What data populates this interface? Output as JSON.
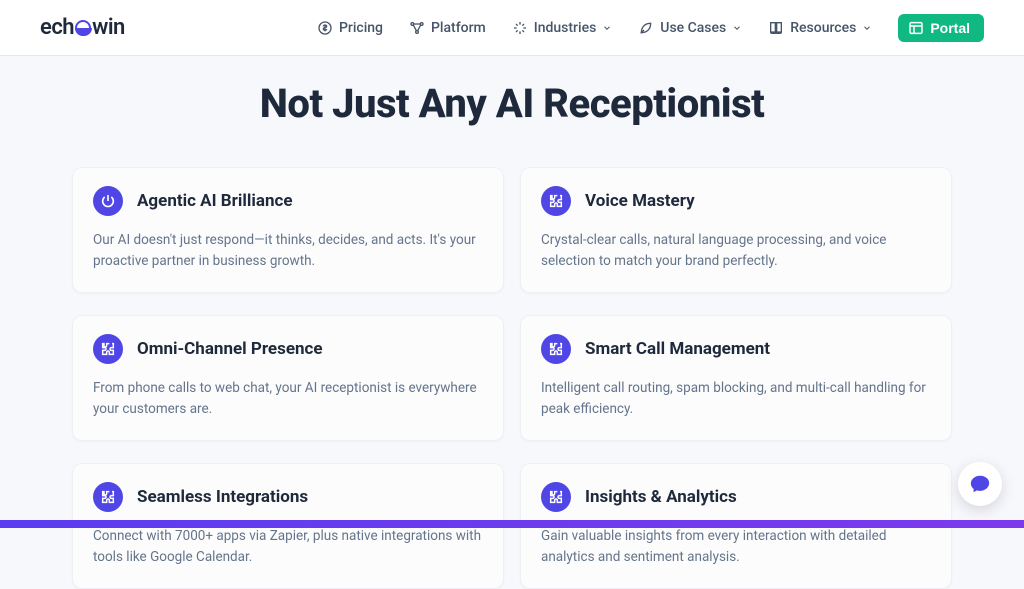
{
  "brand": {
    "ech": "ech",
    "win": "win"
  },
  "nav": {
    "pricing": "Pricing",
    "platform": "Platform",
    "industries": "Industries",
    "use_cases": "Use Cases",
    "resources": "Resources",
    "portal": "Portal"
  },
  "hero": {
    "title": "Not Just Any AI Receptionist"
  },
  "features": [
    {
      "icon": "power-icon",
      "title": "Agentic AI Brilliance",
      "body": "Our AI doesn't just respond—it thinks, decides, and acts. It's your proactive partner in business growth."
    },
    {
      "icon": "puzzle-icon",
      "title": "Voice Mastery",
      "body": "Crystal-clear calls, natural language processing, and voice selection to match your brand perfectly."
    },
    {
      "icon": "puzzle-icon",
      "title": "Omni-Channel Presence",
      "body": "From phone calls to web chat, your AI receptionist is everywhere your customers are."
    },
    {
      "icon": "puzzle-icon",
      "title": "Smart Call Management",
      "body": "Intelligent call routing, spam blocking, and multi-call handling for peak efficiency."
    },
    {
      "icon": "puzzle-icon",
      "title": "Seamless Integrations",
      "body": "Connect with 7000+ apps via Zapier, plus native integrations with tools like Google Calendar."
    },
    {
      "icon": "puzzle-icon",
      "title": "Insights & Analytics",
      "body": "Gain valuable insights from every interaction with detailed analytics and sentiment analysis."
    }
  ],
  "colors": {
    "accent": "#4f46e5",
    "portal": "#10b981",
    "text": "#1e293b",
    "muted": "#64748b"
  }
}
